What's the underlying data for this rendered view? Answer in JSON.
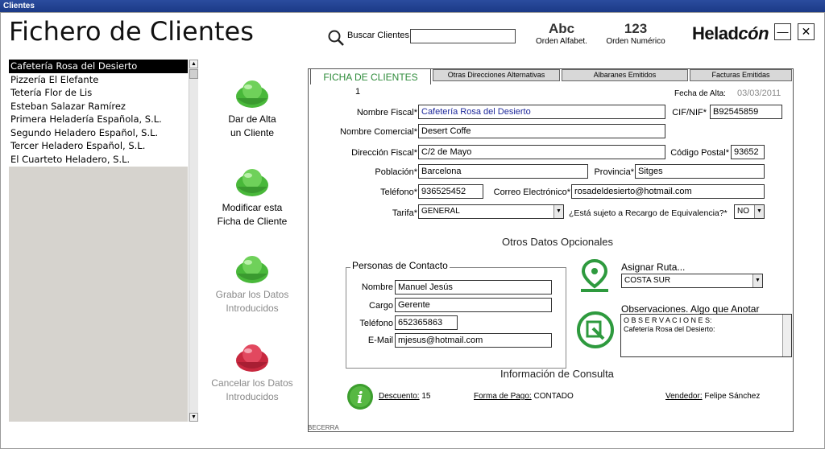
{
  "window": {
    "title": "Clientes"
  },
  "header": {
    "title": "Fichero de Clientes",
    "search_label": "Buscar Clientes",
    "search_value": "",
    "sort_alpha_big": "Abc",
    "sort_alpha_label": "Orden Alfabet.",
    "sort_num_big": "123",
    "sort_num_label": "Orden Numérico",
    "logo_a": "Helad",
    "logo_b": "cón",
    "minimize": "—",
    "close": "✕"
  },
  "client_list": [
    "Cafetería Rosa del Desierto",
    "Pizzería El Elefante",
    "Tetería Flor de Lis",
    "Esteban Salazar Ramírez",
    "Primera Heladería Española, S.L.",
    "Segundo Heladero Español, S.L.",
    "Tercer Heladero Español, S.L.",
    "El Cuarteto Heladero, S.L."
  ],
  "actions": {
    "add_1": "Dar de Alta",
    "add_2": "un Cliente",
    "edit_1": "Modificar esta",
    "edit_2": "Ficha de Cliente",
    "save_1": "Grabar los Datos",
    "save_2": "Introducidos",
    "cancel_1": "Cancelar los Datos",
    "cancel_2": "Introducidos"
  },
  "tabs": [
    "FICHA DE CLIENTES",
    "Otras Direcciones Alternativas",
    "Albaranes Emitidos",
    "Facturas Emitidas"
  ],
  "form": {
    "number": "1",
    "fecha_alta_label": "Fecha de Alta:",
    "fecha_alta": "03/03/2011",
    "nombre_fiscal_label": "Nombre Fiscal*",
    "nombre_fiscal": "Cafetería Rosa del Desierto",
    "cif_label": "CIF/NIF*",
    "cif": "B92545859",
    "nombre_comercial_label": "Nombre Comercial*",
    "nombre_comercial": "Desert Coffe",
    "direccion_label": "Dirección Fiscal*",
    "direccion": "C/2 de Mayo",
    "cp_label": "Código Postal*",
    "cp": "93652",
    "poblacion_label": "Población*",
    "poblacion": "Barcelona",
    "provincia_label": "Provincia*",
    "provincia": "Sitges",
    "telefono_label": "Teléfono*",
    "telefono": "936525452",
    "email_label": "Correo Electrónico*",
    "email": "rosadeldesierto@hotmail.com",
    "tarifa_label": "Tarifa*",
    "tarifa": "GENERAL",
    "recargo_label": "¿Está sujeto a Recargo de Equivalencia?*",
    "recargo": "NO"
  },
  "optional": {
    "title": "Otros Datos Opcionales",
    "contact_title": "Personas de Contacto",
    "c_nombre_label": "Nombre",
    "c_nombre": "Manuel Jesús",
    "c_cargo_label": "Cargo",
    "c_cargo": "Gerente",
    "c_tel_label": "Teléfono",
    "c_tel": "652365863",
    "c_email_label": "E-Mail",
    "c_email": "mjesus@hotmail.com",
    "ruta_label": "Asignar Ruta...",
    "ruta": "COSTA SUR",
    "obs_label": "Observaciones. Algo que Anotar",
    "obs_line1": "O B S E R V A C I O N E S:",
    "obs_line2": "Cafetería Rosa del Desierto:"
  },
  "consulta": {
    "title": "Información de Consulta",
    "descuento_label": "Descuento:",
    "descuento": "15",
    "pago_label": "Forma de Pago:",
    "pago": "CONTADO",
    "vendedor_label": "Vendedor:",
    "vendedor": "Felipe Sánchez"
  },
  "footer": "BECERRA",
  "colors": {
    "accent_green": "#2e8b3a",
    "title_blue": "#1f2a9c"
  }
}
